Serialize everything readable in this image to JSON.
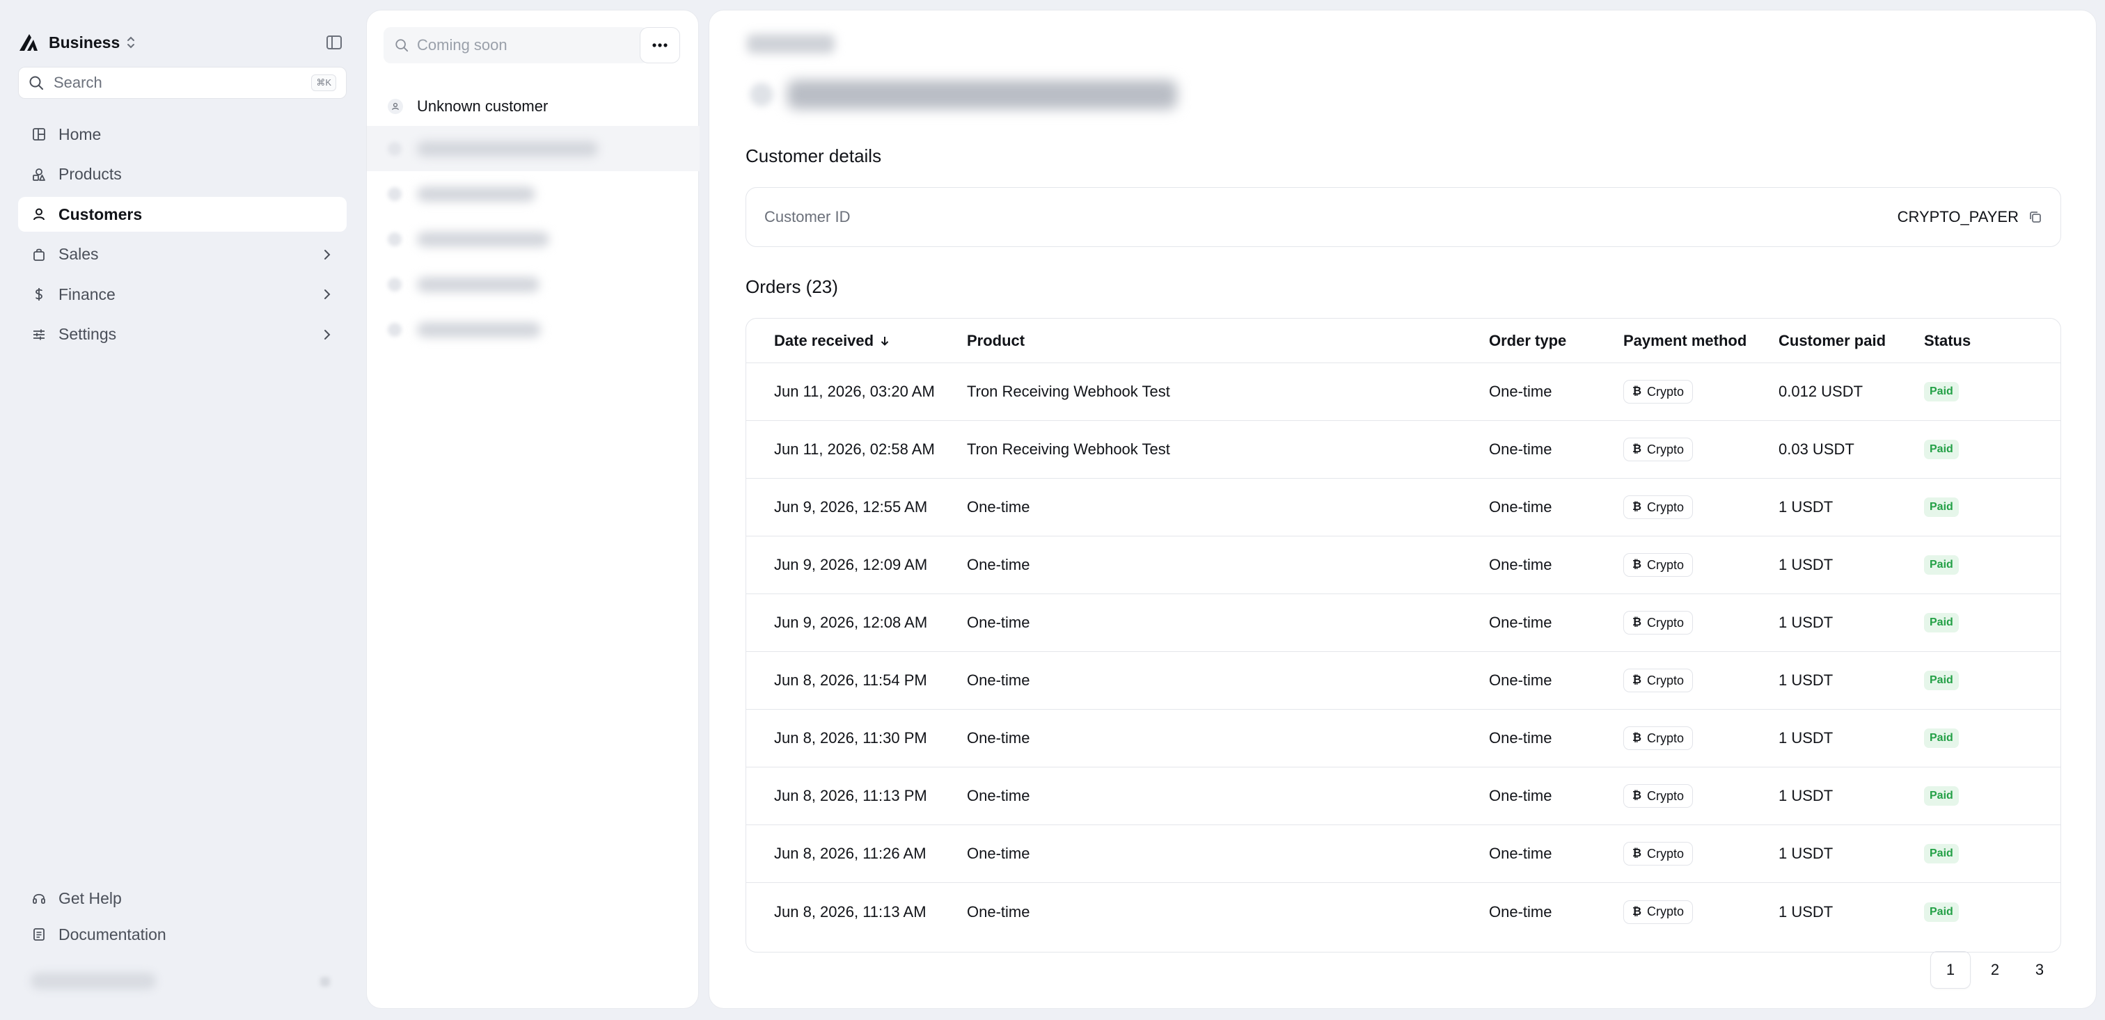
{
  "sidebar": {
    "brand": "Business",
    "search": {
      "placeholder": "Search",
      "shortcut": "⌘K"
    },
    "nav": [
      {
        "label": "Home",
        "icon": "grid-icon"
      },
      {
        "label": "Products",
        "icon": "shapes-icon"
      },
      {
        "label": "Customers",
        "icon": "user-icon"
      },
      {
        "label": "Sales",
        "icon": "bag-icon"
      },
      {
        "label": "Finance",
        "icon": "dollar-icon"
      },
      {
        "label": "Settings",
        "icon": "sliders-icon"
      }
    ],
    "active": "Customers",
    "bottom_nav": [
      {
        "label": "Get Help",
        "icon": "headset-icon"
      },
      {
        "label": "Documentation",
        "icon": "document-icon"
      }
    ]
  },
  "customer_list": {
    "search_placeholder": "Coming soon",
    "items": [
      "Unknown customer"
    ]
  },
  "customer": {
    "details_title": "Customer details",
    "customer_id_label": "Customer ID",
    "customer_id_value": "CRYPTO_PAYER"
  },
  "orders": {
    "title": "Orders (23)",
    "columns": [
      "Date received",
      "Product",
      "Order type",
      "Payment method",
      "Customer paid",
      "Status"
    ],
    "rows": [
      {
        "date": "Jun 11, 2026, 03:20 AM",
        "product": "Tron Receiving Webhook Test",
        "type": "One-time",
        "payment": "Crypto",
        "paid": "0.012 USDT",
        "status": "Paid"
      },
      {
        "date": "Jun 11, 2026, 02:58 AM",
        "product": "Tron Receiving Webhook Test",
        "type": "One-time",
        "payment": "Crypto",
        "paid": "0.03 USDT",
        "status": "Paid"
      },
      {
        "date": "Jun 9, 2026, 12:55 AM",
        "product": "One-time",
        "type": "One-time",
        "payment": "Crypto",
        "paid": "1 USDT",
        "status": "Paid"
      },
      {
        "date": "Jun 9, 2026, 12:09 AM",
        "product": "One-time",
        "type": "One-time",
        "payment": "Crypto",
        "paid": "1 USDT",
        "status": "Paid"
      },
      {
        "date": "Jun 9, 2026, 12:08 AM",
        "product": "One-time",
        "type": "One-time",
        "payment": "Crypto",
        "paid": "1 USDT",
        "status": "Paid"
      },
      {
        "date": "Jun 8, 2026, 11:54 PM",
        "product": "One-time",
        "type": "One-time",
        "payment": "Crypto",
        "paid": "1 USDT",
        "status": "Paid"
      },
      {
        "date": "Jun 8, 2026, 11:30 PM",
        "product": "One-time",
        "type": "One-time",
        "payment": "Crypto",
        "paid": "1 USDT",
        "status": "Paid"
      },
      {
        "date": "Jun 8, 2026, 11:13 PM",
        "product": "One-time",
        "type": "One-time",
        "payment": "Crypto",
        "paid": "1 USDT",
        "status": "Paid"
      },
      {
        "date": "Jun 8, 2026, 11:26 AM",
        "product": "One-time",
        "type": "One-time",
        "payment": "Crypto",
        "paid": "1 USDT",
        "status": "Paid"
      },
      {
        "date": "Jun 8, 2026, 11:13 AM",
        "product": "One-time",
        "type": "One-time",
        "payment": "Crypto",
        "paid": "1 USDT",
        "status": "Paid"
      }
    ]
  },
  "pagination": {
    "pages": [
      "1",
      "2",
      "3"
    ],
    "current": "1"
  },
  "colors": {
    "background": "#eef0f5",
    "panel": "#ffffff",
    "paid_badge_bg": "#e6f6ea",
    "paid_badge_text": "#23a046"
  }
}
